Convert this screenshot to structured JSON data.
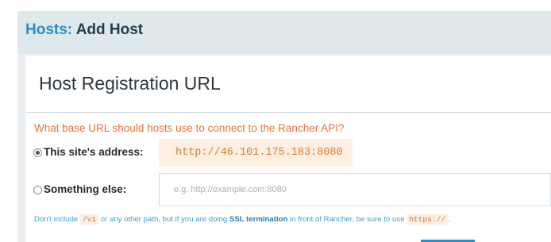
{
  "header": {
    "breadcrumb": "Hosts:",
    "title": "Add Host"
  },
  "section": {
    "title": "Host Registration URL"
  },
  "question": "What base URL should hosts use to connect to the Rancher API?",
  "options": {
    "this_site": {
      "label": "This site's address:",
      "value": "http://46.101.175.183:8080",
      "checked": true
    },
    "something_else": {
      "label": "Something else:",
      "placeholder": "e.g. http://example.com:8080",
      "value": "",
      "checked": false
    }
  },
  "help": {
    "prefix": "Don't include",
    "path_code": "/v1",
    "middle": "or any other path, but if you are doing",
    "ssl": "SSL termination",
    "suffix": "in front of Rancher, be sure to use",
    "https_code": "https://",
    "end": "."
  },
  "colors": {
    "accent": "#2a8fc7",
    "warning": "#e8743b",
    "header_bg": "#dfe9ec"
  }
}
